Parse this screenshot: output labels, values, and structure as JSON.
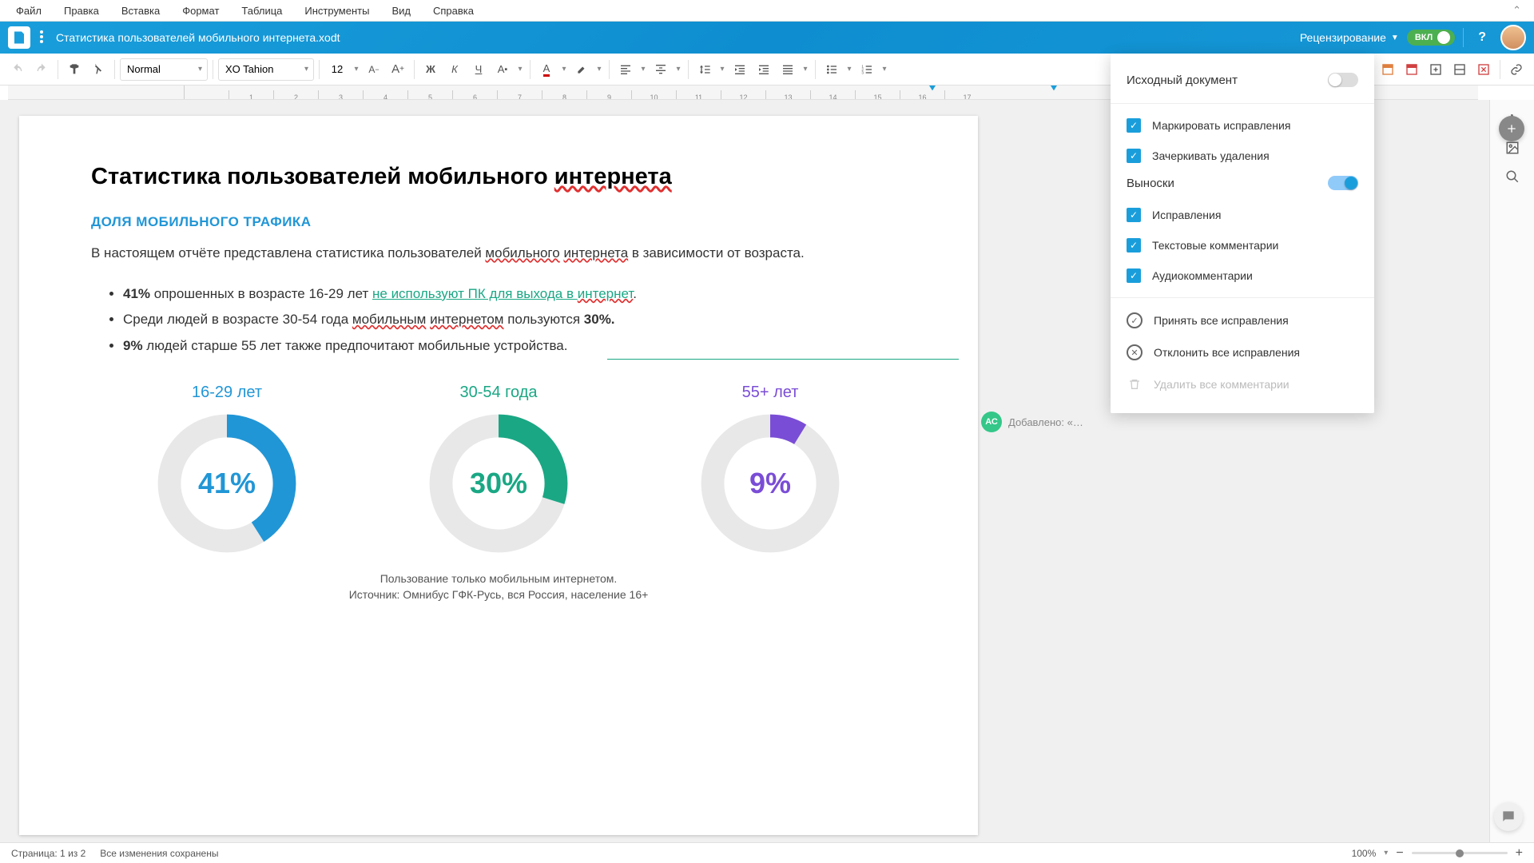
{
  "menubar": {
    "items": [
      "Файл",
      "Правка",
      "Вставка",
      "Формат",
      "Таблица",
      "Инструменты",
      "Вид",
      "Справка"
    ]
  },
  "titlebar": {
    "filename": "Статистика пользователей мобильного интернета.xodt",
    "review_label": "Рецензирование",
    "toggle_label": "ВКЛ"
  },
  "toolbar": {
    "style": "Normal",
    "font": "XO Tahion",
    "fontsize": "12"
  },
  "ruler": {
    "marks": [
      "",
      "1",
      "2",
      "3",
      "4",
      "5",
      "6",
      "7",
      "8",
      "9",
      "10",
      "11",
      "12",
      "13",
      "14",
      "15",
      "16",
      "17"
    ]
  },
  "document": {
    "title_pre": "Статистика пользователей мобильного ",
    "title_underlined": "интернета",
    "section": "ДОЛЯ МОБИЛЬНОГО ТРАФИКА",
    "para_1": "В настоящем отчёте представлена статистика пользователей ",
    "para_1_w1": "мобильного",
    "para_1_mid": " ",
    "para_1_w2": "интернета",
    "para_1_end": " в зависимости от возраста.",
    "bullet1_pct": "41%",
    "bullet1_text": " опрошенных в возрасте 16-29 лет ",
    "bullet1_insert": "не используют ПК для выхода в ",
    "bullet1_insert2": "интернет",
    "bullet1_dot": ".",
    "bullet2_pre": "Среди людей в возрасте 30-54 года ",
    "bullet2_w1": "мобильным",
    "bullet2_w2": "интернетом",
    "bullet2_end": " пользуются ",
    "bullet2_pct": "30%.",
    "bullet3_pct": "9%",
    "bullet3_text": " людей старше 55 лет также предпочитают мобильные устройства.",
    "footer_line1": "Пользование только мобильным интернетом.",
    "footer_line2": "Источник: Омнибус ГФК-Русь, вся Россия, население 16+"
  },
  "chart_data": {
    "type": "pie",
    "series": [
      {
        "name": "16-29 лет",
        "value": 41,
        "color": "#2196d6"
      },
      {
        "name": "30-54 года",
        "value": 30,
        "color": "#1aa784"
      },
      {
        "name": "55+ лет",
        "value": 9,
        "color": "#7a4dd6"
      }
    ],
    "labels": {
      "l1": "16-29 лет",
      "l2": "30-54 года",
      "l3": "55+ лет",
      "c1": "41%",
      "c2": "30%",
      "c3": "9%"
    }
  },
  "comment": {
    "initials": "АС",
    "text": "Добавлено: «…"
  },
  "review_panel": {
    "original_doc": "Исходный документ",
    "mark_fixes": "Маркировать исправления",
    "strike_deletes": "Зачеркивать удаления",
    "callouts": "Выноски",
    "fixes": "Исправления",
    "text_comments": "Текстовые комментарии",
    "audio_comments": "Аудиокомментарии",
    "accept_all": "Принять все исправления",
    "reject_all": "Отклонить все исправления",
    "delete_all": "Удалить все комментарии"
  },
  "statusbar": {
    "page": "Страница: 1 из 2",
    "saved": "Все изменения сохранены",
    "zoom": "100%"
  }
}
